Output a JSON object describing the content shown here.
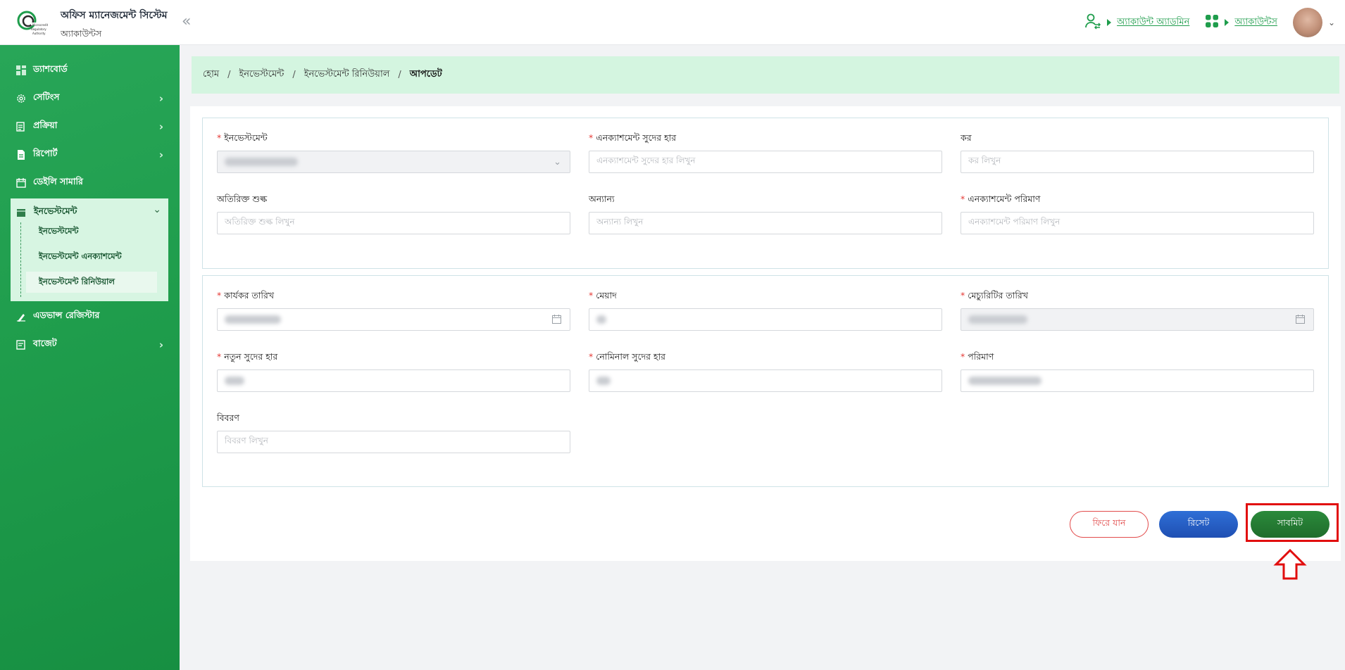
{
  "header": {
    "app_title": "অফিস ম্যানেজমেন্ট সিস্টেম",
    "app_sub": "অ্যাকাউন্টস",
    "collapse_icon": "«",
    "user_link": "অ্যাকাউন্ট অ্যাডমিন",
    "module_link": "অ্যাকাউন্টস",
    "avatar_caret": "⌄"
  },
  "sidebar": {
    "items": [
      {
        "label": "ড্যাশবোর্ড"
      },
      {
        "label": "সেটিংস"
      },
      {
        "label": "প্রক্রিয়া"
      },
      {
        "label": "রিপোর্ট"
      },
      {
        "label": "ডেইলি সামারি"
      },
      {
        "label": "ইনভেস্টমেন্ট"
      },
      {
        "label": "এডভান্স রেজিস্টার"
      },
      {
        "label": "বাজেট"
      }
    ],
    "sub_items": [
      {
        "label": "ইনভেস্টমেন্ট"
      },
      {
        "label": "ইনভেস্টমেন্ট এনক্যাশমেন্ট"
      },
      {
        "label": "ইনভেস্টমেন্ট রিনিউয়াল"
      }
    ]
  },
  "breadcrumb": {
    "home": "হোম",
    "investment": "ইনভেস্টমেন্ট",
    "renewal": "ইনভেস্টমেন্ট রিনিউয়াল",
    "current": "আপডেট",
    "separator": "/"
  },
  "form": {
    "investment": {
      "label": "ইনভেস্টমেন্ট"
    },
    "encash_rate": {
      "label": "এনক্যাশমেন্ট সুদের হার",
      "placeholder": "এনক্যাশমেন্ট সুদের হার লিখুন"
    },
    "tax": {
      "label": "কর",
      "placeholder": "কর লিখুন"
    },
    "extra_fee": {
      "label": "অতিরিক্ত শুল্ক",
      "placeholder": "অতিরিক্ত শুল্ক লিখুন"
    },
    "other": {
      "label": "অন্যান্য",
      "placeholder": "অন্যান্য লিখুন"
    },
    "encash_amount": {
      "label": "এনক্যাশমেন্ট পরিমাণ",
      "placeholder": "এনক্যাশমেন্ট পরিমাণ লিখুন"
    },
    "effective_date": {
      "label": "কার্যকর তারিখ"
    },
    "tenure": {
      "label": "মেয়াদ"
    },
    "maturity_date": {
      "label": "মেচ্যুরিটির তারিখ"
    },
    "new_rate": {
      "label": "নতুন সুদের হার"
    },
    "nominal_rate": {
      "label": "নোমিনাল সুদের হার"
    },
    "amount": {
      "label": "পরিমাণ"
    },
    "description": {
      "label": "বিবরণ",
      "placeholder": "বিবরণ লিখুন"
    },
    "required_mark": "*"
  },
  "buttons": {
    "back": "ফিরে যান",
    "reset": "রিসেট",
    "submit": "সাবমিট"
  },
  "colors": {
    "brand_green": "#1f9d4c",
    "breadcrumb_bg": "#d4f5e0",
    "reset_blue": "#2459c4",
    "submit_green": "#257a33",
    "highlight_red": "#e10e0e"
  }
}
